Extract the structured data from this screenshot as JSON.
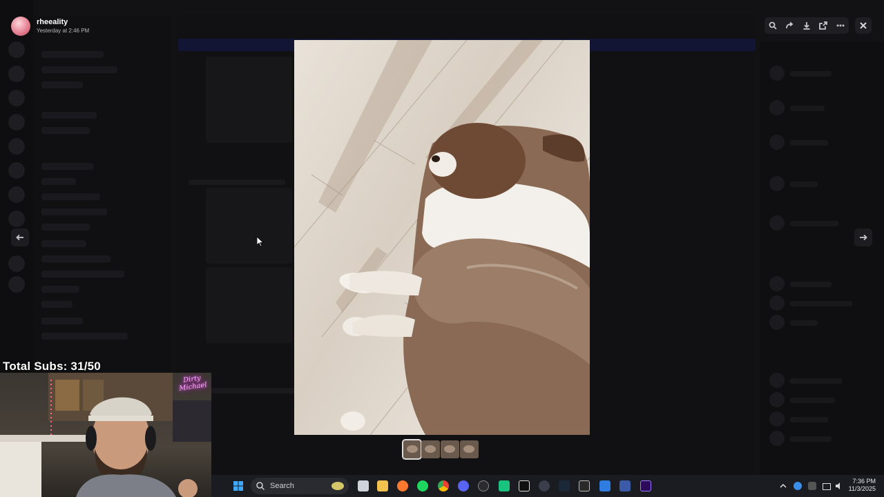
{
  "viewer": {
    "uploader_name": "rheeality",
    "uploader_time": "Yesterday at 2:46 PM",
    "thumbnails_count": 4,
    "active_thumbnail": 1
  },
  "toolbar": {
    "icons": [
      "zoom-icon",
      "forward-icon",
      "download-icon",
      "open-external-icon",
      "more-icon",
      "close-icon"
    ]
  },
  "overlay": {
    "subs_text": "Total Subs: 31/50",
    "neon_text": "Dirty Michael"
  },
  "taskbar": {
    "search_label": "Search",
    "time": "7:36 PM",
    "date": "11/3/2025"
  },
  "colors": {
    "background": "#0b0b0d",
    "toolbar": "#1f1f23",
    "taskbar": "#1b1c22",
    "neon": "#ff4fe6"
  }
}
